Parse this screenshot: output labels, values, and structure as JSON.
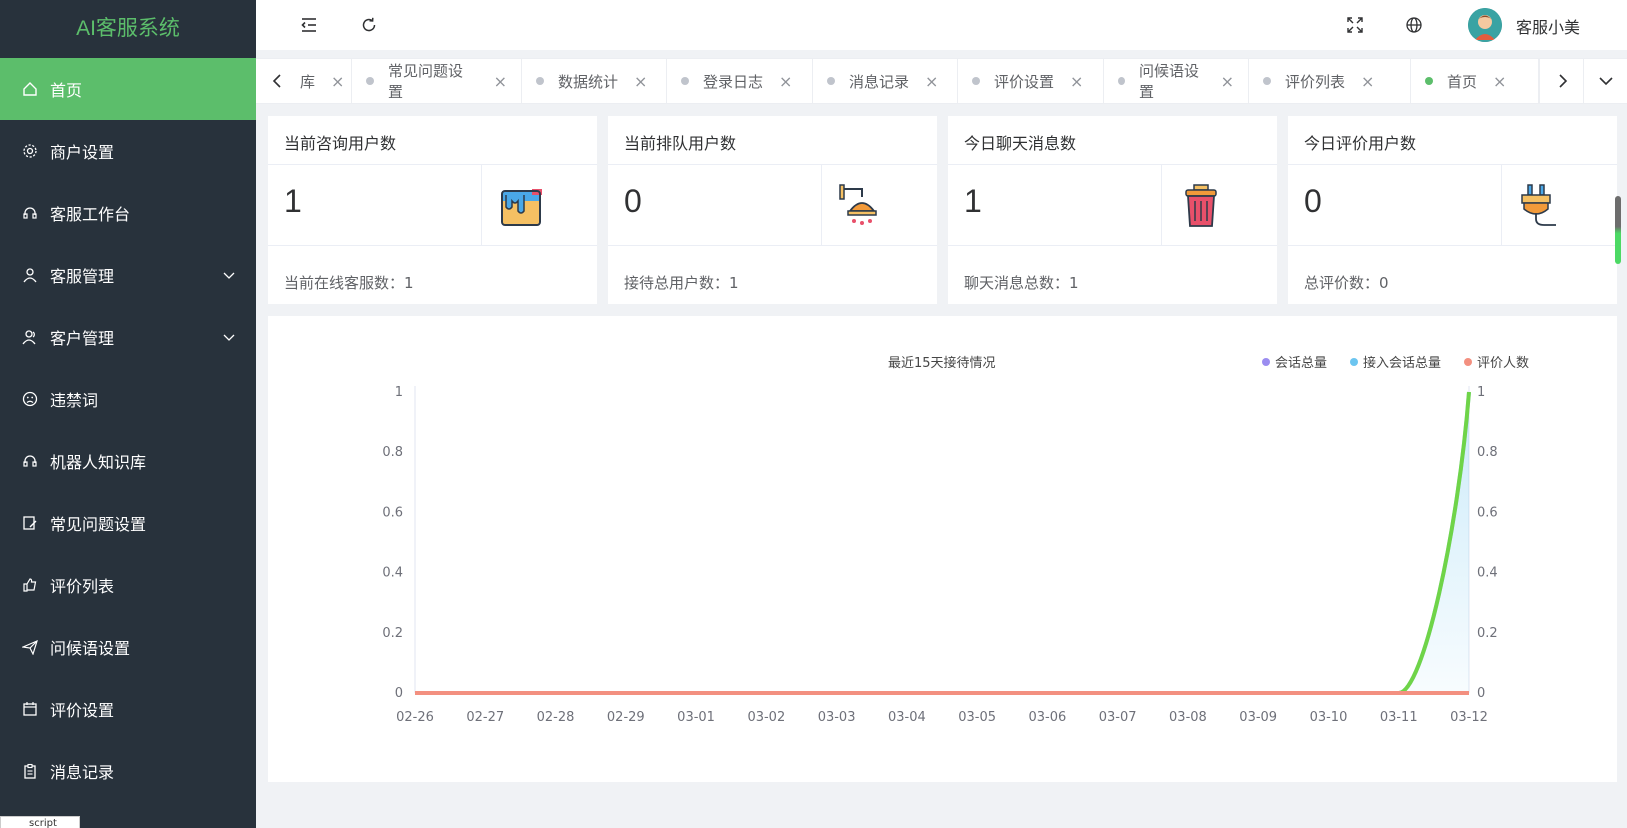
{
  "app": {
    "title": "AI客服系统"
  },
  "sidebar": {
    "items": [
      {
        "label": "首页",
        "icon": "home-icon",
        "active": true
      },
      {
        "label": "商户设置",
        "icon": "gear-icon"
      },
      {
        "label": "客服工作台",
        "icon": "headset-icon"
      },
      {
        "label": "客服管理",
        "icon": "user-icon",
        "expandable": true
      },
      {
        "label": "客户管理",
        "icon": "users-icon",
        "expandable": true
      },
      {
        "label": "违禁词",
        "icon": "sad-face-icon"
      },
      {
        "label": "机器人知识库",
        "icon": "headset-icon"
      },
      {
        "label": "常见问题设置",
        "icon": "edit-doc-icon"
      },
      {
        "label": "评价列表",
        "icon": "thumb-up-icon"
      },
      {
        "label": "问候语设置",
        "icon": "send-icon"
      },
      {
        "label": "评价设置",
        "icon": "calendar-icon"
      },
      {
        "label": "消息记录",
        "icon": "clipboard-icon"
      }
    ],
    "script_label": "script"
  },
  "header": {
    "user_name": "客服小美"
  },
  "tabs": {
    "items": [
      {
        "label": "库"
      },
      {
        "label": "常见问题设置"
      },
      {
        "label": "数据统计"
      },
      {
        "label": "登录日志"
      },
      {
        "label": "消息记录"
      },
      {
        "label": "评价设置"
      },
      {
        "label": "问候语设置"
      },
      {
        "label": "评价列表"
      },
      {
        "label": "首页",
        "active": true
      }
    ],
    "close_glyph": "×"
  },
  "cards": [
    {
      "title": "当前咨询用户数",
      "value": "1",
      "footer": "当前在线客服数：1",
      "icon": "paint-bucket-icon"
    },
    {
      "title": "当前排队用户数",
      "value": "0",
      "footer": "接待总用户数：1",
      "icon": "shower-icon"
    },
    {
      "title": "今日聊天消息数",
      "value": "1",
      "footer": "聊天消息总数：1",
      "icon": "trash-can-icon"
    },
    {
      "title": "今日评价用户数",
      "value": "0",
      "footer": "总评价数：0",
      "icon": "plug-icon"
    }
  ],
  "chart_data": {
    "type": "line",
    "title": "最近15天接待情况",
    "categories": [
      "02-26",
      "02-27",
      "02-28",
      "02-29",
      "03-01",
      "03-02",
      "03-03",
      "03-04",
      "03-05",
      "03-06",
      "03-07",
      "03-08",
      "03-09",
      "03-10",
      "03-11",
      "03-12"
    ],
    "series": [
      {
        "name": "会话总量",
        "color": "#9b8df0",
        "values": [
          0,
          0,
          0,
          0,
          0,
          0,
          0,
          0,
          0,
          0,
          0,
          0,
          0,
          0,
          0,
          1
        ]
      },
      {
        "name": "接入会话总量",
        "color": "#6cc5f0",
        "values": [
          0,
          0,
          0,
          0,
          0,
          0,
          0,
          0,
          0,
          0,
          0,
          0,
          0,
          0,
          0,
          1
        ]
      },
      {
        "name": "评价人数",
        "color": "#f39080",
        "values": [
          0,
          0,
          0,
          0,
          0,
          0,
          0,
          0,
          0,
          0,
          0,
          0,
          0,
          0,
          0,
          0
        ]
      }
    ],
    "yticks": [
      "0",
      "0.2",
      "0.4",
      "0.6",
      "0.8",
      "1"
    ],
    "ylim": [
      0,
      1
    ],
    "legend_position": "top-right",
    "grid": false
  }
}
